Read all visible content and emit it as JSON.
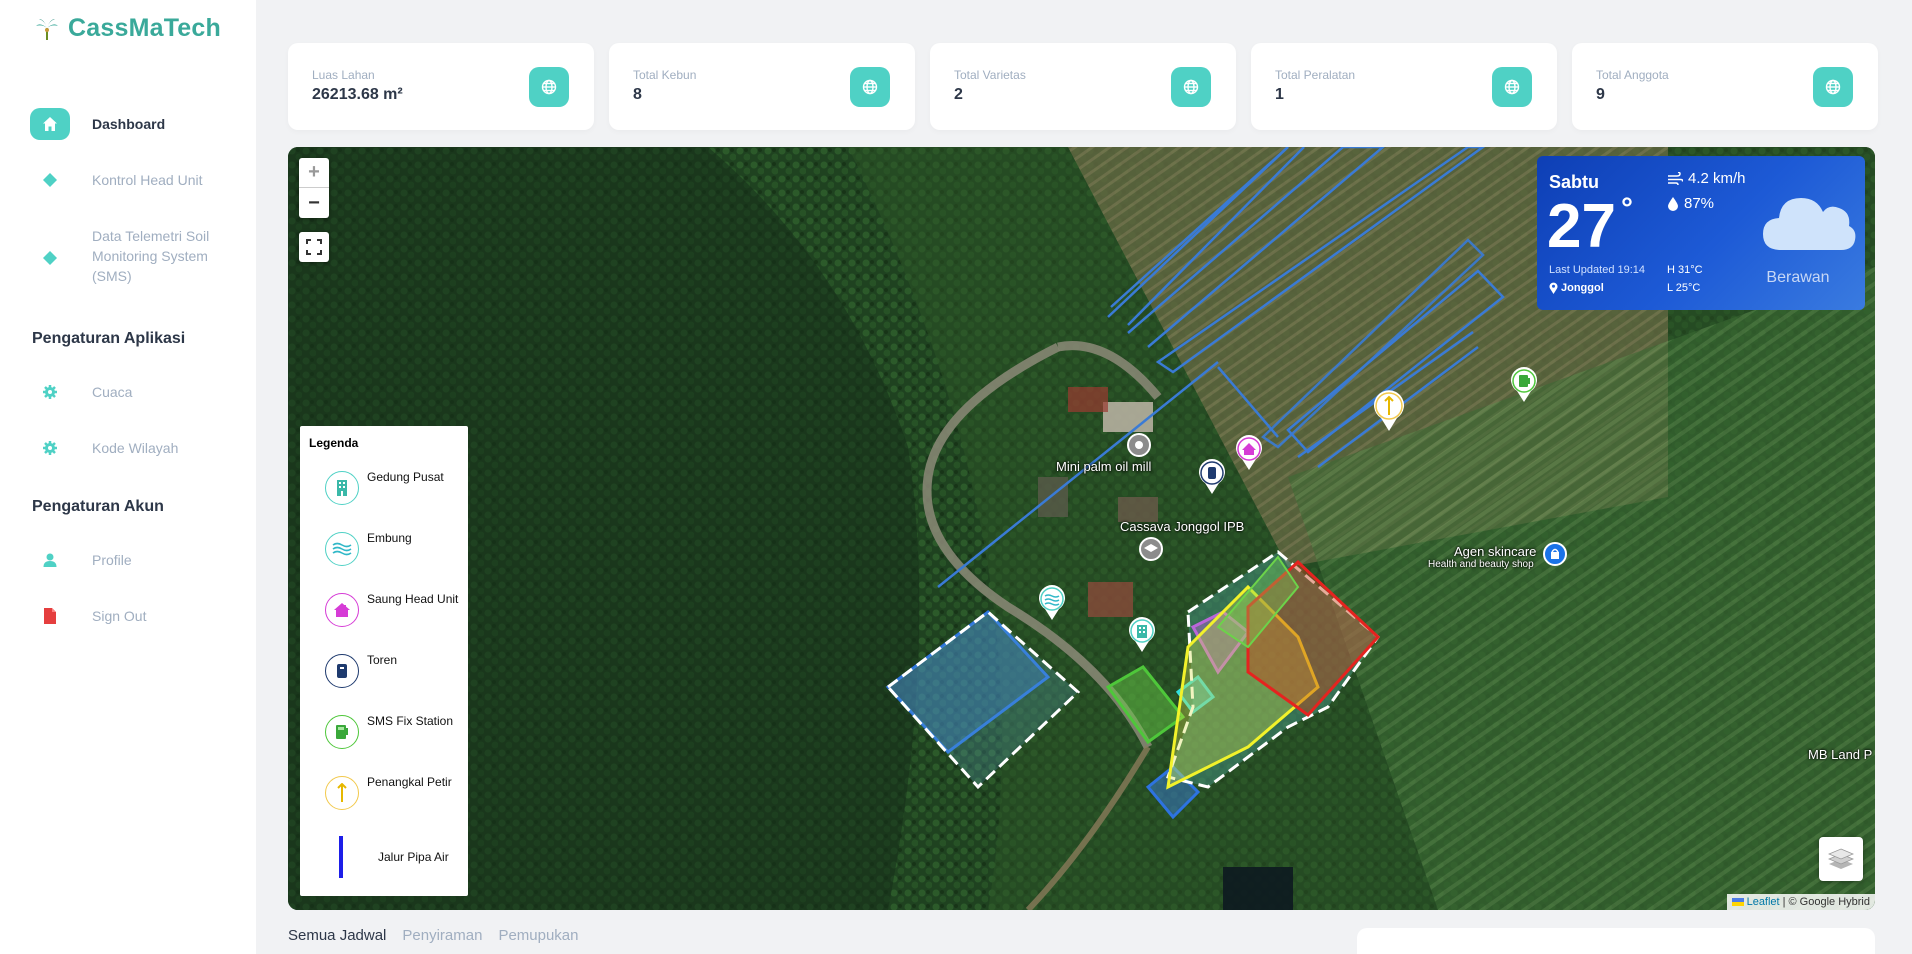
{
  "brand": {
    "name": "CassMaTech"
  },
  "sidebar": {
    "items": [
      {
        "label": "Dashboard",
        "icon": "home-icon"
      },
      {
        "label": "Kontrol Head Unit",
        "icon": "diamond-icon"
      },
      {
        "label": "Data Telemetri Soil Monitoring System (SMS)",
        "icon": "diamond-icon"
      }
    ],
    "section_app": "Pengaturan Aplikasi",
    "app_items": [
      {
        "label": "Cuaca",
        "icon": "gear-icon"
      },
      {
        "label": "Kode Wilayah",
        "icon": "gear-icon"
      }
    ],
    "section_account": "Pengaturan Akun",
    "account_items": [
      {
        "label": "Profile",
        "icon": "user-icon"
      },
      {
        "label": "Sign Out",
        "icon": "document-icon"
      }
    ]
  },
  "stats": [
    {
      "label": "Luas Lahan",
      "value": "26213.68 m²"
    },
    {
      "label": "Total Kebun",
      "value": "8"
    },
    {
      "label": "Total Varietas",
      "value": "2"
    },
    {
      "label": "Total Peralatan",
      "value": "1"
    },
    {
      "label": "Total Anggota",
      "value": "9"
    }
  ],
  "map": {
    "zoom_in": "+",
    "zoom_out": "−",
    "labels": {
      "mill": "Mini palm oil mill",
      "cassava": "Cassava Jonggol IPB",
      "agen": "Agen skincare",
      "agen_sub": "Health and beauty shop",
      "mb_land": "MB Land P"
    },
    "attribution_leaflet": "Leaflet",
    "attribution_rest": "| © Google Hybrid"
  },
  "legend": {
    "title": "Legenda",
    "items": [
      {
        "label": "Gedung Pusat",
        "icon": "building-icon"
      },
      {
        "label": "Embung",
        "icon": "water-icon"
      },
      {
        "label": "Saung Head Unit",
        "icon": "hut-icon"
      },
      {
        "label": "Toren",
        "icon": "tank-icon"
      },
      {
        "label": "SMS Fix Station",
        "icon": "station-icon"
      },
      {
        "label": "Penangkal Petir",
        "icon": "lightning-rod-icon"
      },
      {
        "label": "Jalur Pipa Air",
        "icon": "pipe-line-icon"
      }
    ]
  },
  "weather": {
    "day": "Sabtu",
    "temperature": "27",
    "degree": "°",
    "wind": "4.2 km/h",
    "humidity": "87%",
    "last_updated": "Last Updated 19:14",
    "location": "Jonggol",
    "high": "H 31°C",
    "low": "L 25°C",
    "condition": "Berawan"
  },
  "tabs": [
    {
      "label": "Semua Jadwal"
    },
    {
      "label": "Penyiraman"
    },
    {
      "label": "Pemupukan"
    }
  ],
  "colors": {
    "accent": "#4fd1c5",
    "brand": "#3aa99a",
    "weather_bg": "#1d5ad6",
    "pipe": "#1d1ee8"
  }
}
